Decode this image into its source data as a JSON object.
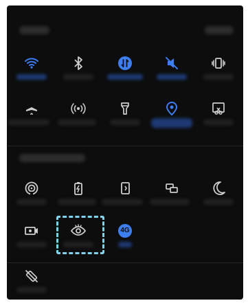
{
  "colors": {
    "panel_bg": "#0d0d0d",
    "active": "#3d7ef0",
    "inactive": "#cfcfcf",
    "highlight": "#7fd3ee"
  },
  "header": {
    "left_label": "",
    "right_label": ""
  },
  "section_title": "",
  "toggles": [
    {
      "icon": "wifi-icon",
      "active": true
    },
    {
      "icon": "bluetooth-icon",
      "active": false
    },
    {
      "icon": "mobile-data-icon",
      "active": true
    },
    {
      "icon": "sound-muted-icon",
      "active": true
    },
    {
      "icon": "vibrate-icon",
      "active": false
    },
    {
      "icon": "airplane-mode-icon",
      "active": false
    },
    {
      "icon": "hotspot-icon",
      "active": false
    },
    {
      "icon": "flashlight-icon",
      "active": false
    },
    {
      "icon": "location-icon",
      "active": true
    },
    {
      "icon": "screenshot-icon",
      "active": false
    },
    {
      "icon": "nfc-icon",
      "active": false
    },
    {
      "icon": "battery-saver-icon",
      "active": false
    },
    {
      "icon": "rotate-screen-icon",
      "active": false
    },
    {
      "icon": "screen-mirror-icon",
      "active": false
    },
    {
      "icon": "do-not-disturb-icon",
      "active": false
    },
    {
      "icon": "screen-recorder-icon",
      "active": false
    },
    {
      "icon": "eye-comfort-icon",
      "active": false
    },
    {
      "icon": "4g-icon",
      "active": true
    },
    {
      "icon": "auto-rotate-off-icon",
      "active": false
    }
  ],
  "badge_4g": "4G"
}
